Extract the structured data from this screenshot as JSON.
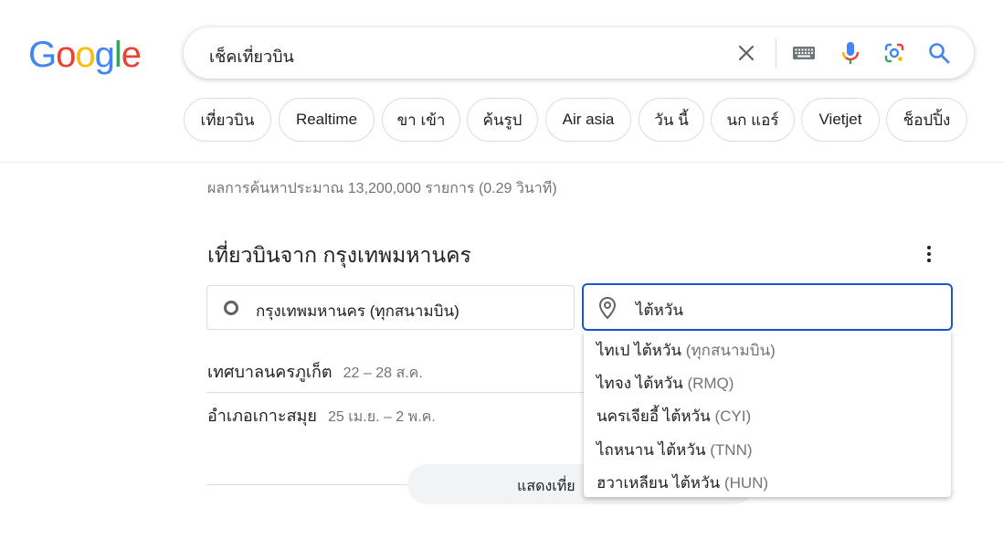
{
  "logo": {
    "letters": [
      "G",
      "o",
      "o",
      "g",
      "l",
      "e"
    ]
  },
  "search": {
    "query": "เช็คเที่ยวบิน"
  },
  "chips": [
    "เที่ยวบิน",
    "Realtime",
    "ขา เข้า",
    "ค้นรูป",
    "Air asia",
    "วัน นี้",
    "นก แอร์",
    "Vietjet",
    "ช็อปปิ้ง"
  ],
  "result_stats": "ผลการค้นหาประมาณ 13,200,000 รายการ (0.29 วินาที)",
  "flights": {
    "title": "เที่ยวบินจาก กรุงเทพมหานคร",
    "origin": "กรุงเทพมหานคร (ทุกสนามบิน)",
    "destination": "ไต้หวัน",
    "suggestions": [
      {
        "name": "เทศบาลนครภูเก็ต",
        "dates": "22 – 28 ส.ค."
      },
      {
        "name": "อำเภอเกาะสมุย",
        "dates": "25 เม.ย. – 2 พ.ค."
      }
    ],
    "show_more": "แสดงเที่ย"
  },
  "dropdown": [
    {
      "name": "ไทเป ไต้หวัน",
      "code": "(ทุกสนามบิน)"
    },
    {
      "name": "ไทจง ไต้หวัน",
      "code": "(RMQ)"
    },
    {
      "name": "นครเจียอี้ ไต้หวัน",
      "code": "(CYI)"
    },
    {
      "name": "ไถหนาน ไต้หวัน",
      "code": "(TNN)"
    },
    {
      "name": "ฮวาเหลียน ไต้หวัน",
      "code": "(HUN)"
    }
  ]
}
